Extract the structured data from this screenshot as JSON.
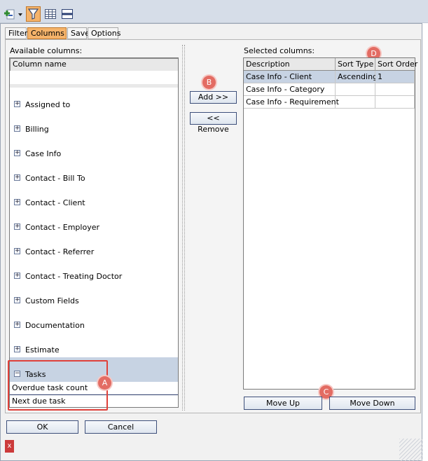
{
  "toolbar": {
    "icons": [
      {
        "name": "add-report-icon"
      },
      {
        "name": "dropdown-arrow-icon"
      },
      {
        "name": "filter-icon",
        "active": true
      },
      {
        "name": "table-icon"
      },
      {
        "name": "panel-icon"
      }
    ]
  },
  "tabs": [
    "Filter",
    "Columns",
    "Save",
    "Options"
  ],
  "active_tab": "Columns",
  "available": {
    "title": "Available columns:",
    "header": "Column name",
    "groups": [
      "Assigned to",
      "Billing",
      "Case Info",
      "Contact - Bill To",
      "Contact - Client",
      "Contact - Employer",
      "Contact - Referrer",
      "Contact - Treating Doctor",
      "Custom Fields",
      "Documentation",
      "Estimate"
    ],
    "expanded_group": "Tasks",
    "expanded_items": [
      "Overdue task count",
      "Next due task"
    ]
  },
  "buttons": {
    "add": "Add >>",
    "remove": "<< Remove",
    "move_up": "Move Up",
    "move_down": "Move Down",
    "ok": "OK",
    "cancel": "Cancel"
  },
  "selected": {
    "title": "Selected columns:",
    "headers": [
      "Description",
      "Sort Type",
      "Sort Order"
    ],
    "rows": [
      [
        "Case Info - Client",
        "Ascending",
        "1"
      ],
      [
        "Case Info - Category",
        "",
        ""
      ],
      [
        "Case Info - Requirement",
        "",
        ""
      ]
    ]
  },
  "badges": [
    "A",
    "B",
    "C",
    "D"
  ],
  "close_glyph": "x",
  "colors": {
    "accent": "#f5b36a",
    "selection": "#c7d3e3",
    "badge": "#e36c63",
    "highlight": "#e0413a"
  }
}
